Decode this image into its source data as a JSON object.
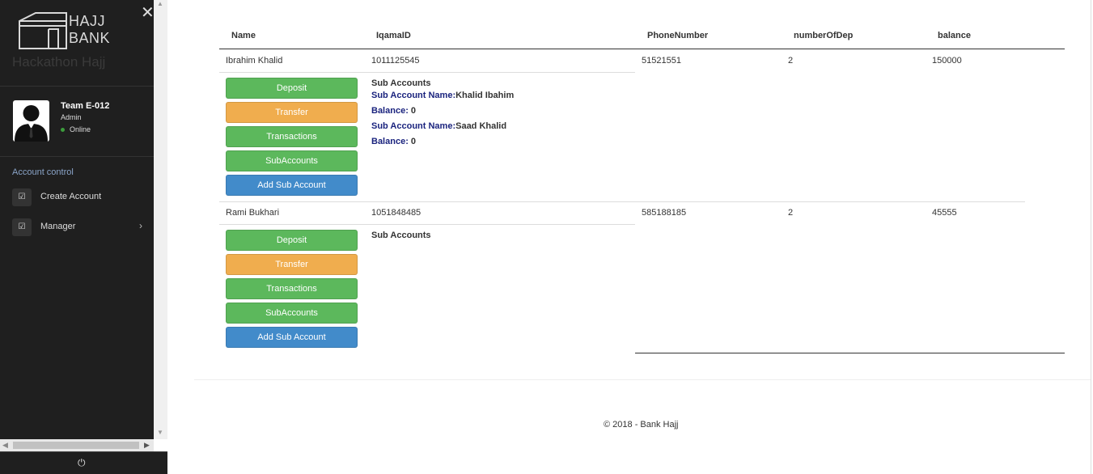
{
  "sidebar": {
    "logo_text_line1": "HAJJ",
    "logo_text_line2": "BANK",
    "subtitle": "Hackathon Hajj",
    "profile": {
      "name": "Team E-012",
      "role": "Admin",
      "status": "Online"
    },
    "menu_header": "Account control",
    "items": [
      {
        "label": "Create Account",
        "icon": "checkbox-icon"
      },
      {
        "label": "Manager",
        "icon": "checkbox-icon",
        "has_chevron": true
      }
    ]
  },
  "table": {
    "headers": [
      "Name",
      "IqamaID",
      "PhoneNumber",
      "numberOfDep",
      "balance"
    ],
    "rows": [
      {
        "name": "Ibrahim Khalid",
        "iqama": "1011125545",
        "phone": "51521551",
        "deps": "2",
        "balance": "150000",
        "actions": [
          "Deposit",
          "Transfer",
          "Transactions",
          "SubAccounts",
          "Add Sub Account"
        ],
        "sub_title": "Sub Accounts",
        "sub_accounts": [
          {
            "name_label": "Sub Account Name:",
            "name": "Khalid Ibahim",
            "balance_label": "Balance:",
            "balance": "0"
          },
          {
            "name_label": "Sub Account Name:",
            "name": "Saad Khalid",
            "balance_label": "Balance:",
            "balance": "0"
          }
        ]
      },
      {
        "name": "Rami Bukhari",
        "iqama": "1051848485",
        "phone": "585188185",
        "deps": "2",
        "balance": "45555",
        "actions": [
          "Deposit",
          "Transfer",
          "Transactions",
          "SubAccounts",
          "Add Sub Account"
        ],
        "sub_title": "Sub Accounts",
        "sub_accounts": []
      }
    ]
  },
  "footer": {
    "copyright": "© 2018 - Bank Hajj"
  },
  "colors": {
    "sidebar_bg": "#1f1f1f",
    "green": "#5cb85c",
    "orange": "#f0ad4e",
    "blue": "#428bca",
    "sub_label": "#1a237e"
  }
}
